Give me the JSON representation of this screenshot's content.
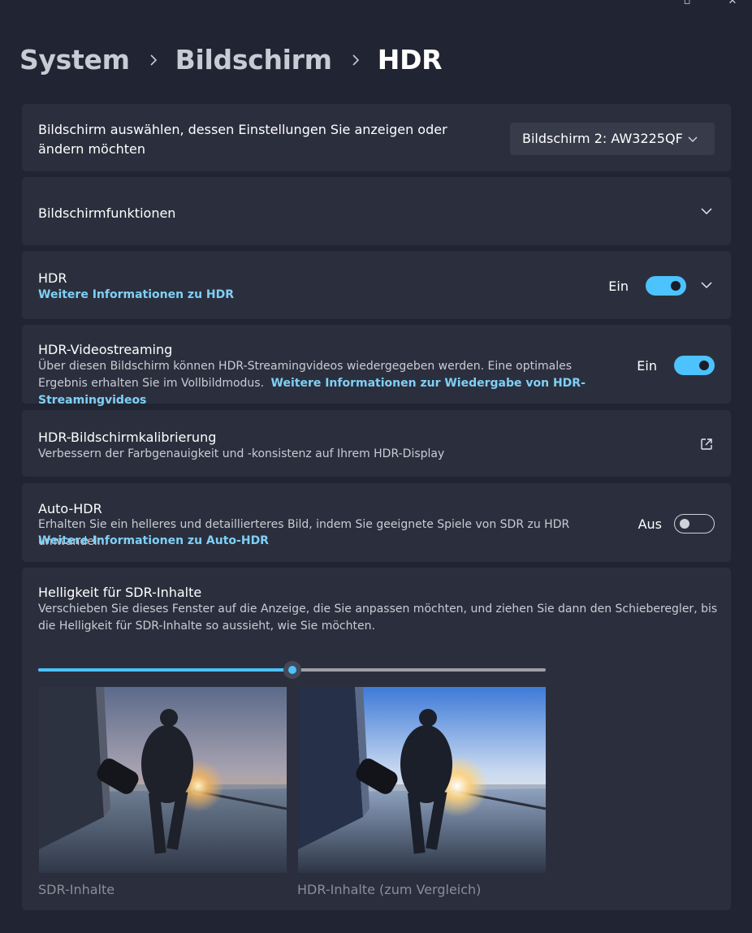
{
  "breadcrumb": {
    "items": [
      "System",
      "Bildschirm"
    ],
    "current": "HDR"
  },
  "display_select": {
    "label": "Bildschirm auswählen, dessen Einstellungen Sie anzeigen oder ändern möchten",
    "value": "Bildschirm 2: AW3225QF"
  },
  "display_features": {
    "title": "Bildschirmfunktionen"
  },
  "hdr": {
    "title": "HDR",
    "link": "Weitere Informationen zu HDR",
    "state_label": "Ein",
    "on": true
  },
  "hdr_video": {
    "title": "HDR-Videostreaming",
    "desc": "Über diesen Bildschirm können HDR-Streamingvideos wiedergegeben werden. Eine optimales Ergebnis erhalten Sie im Vollbildmodus.",
    "link": "Weitere Informationen zur Wiedergabe von HDR-Streamingvideos",
    "state_label": "Ein",
    "on": true
  },
  "hdr_calibration": {
    "title": "HDR-Bildschirmkalibrierung",
    "desc": "Verbessern der Farbgenauigkeit und -konsistenz auf Ihrem HDR-Display",
    "icon": "open-external-icon"
  },
  "auto_hdr": {
    "title": "Auto-HDR",
    "desc": "Erhalten Sie ein helleres und detaillierteres Bild, indem Sie geeignete Spiele von SDR zu HDR umwandeln.",
    "link": "Weitere Informationen zu Auto-HDR",
    "state_label": "Aus",
    "on": false
  },
  "sdr_brightness": {
    "title": "Helligkeit für SDR-Inhalte",
    "desc": "Verschieben Sie dieses Fenster auf die Anzeige, die Sie anpassen möchten, und ziehen Sie dann den Schieberegler, bis die Helligkeit für SDR-Inhalte so aussieht, wie Sie möchten.",
    "slider_value_percent": 50,
    "sdr_caption": "SDR-Inhalte",
    "hdr_caption": "HDR-Inhalte (zum Vergleich)"
  },
  "colors": {
    "background": "#202433",
    "card": "#2b2f3d",
    "accent": "#4cc2ff",
    "link": "#7fd0f6"
  }
}
